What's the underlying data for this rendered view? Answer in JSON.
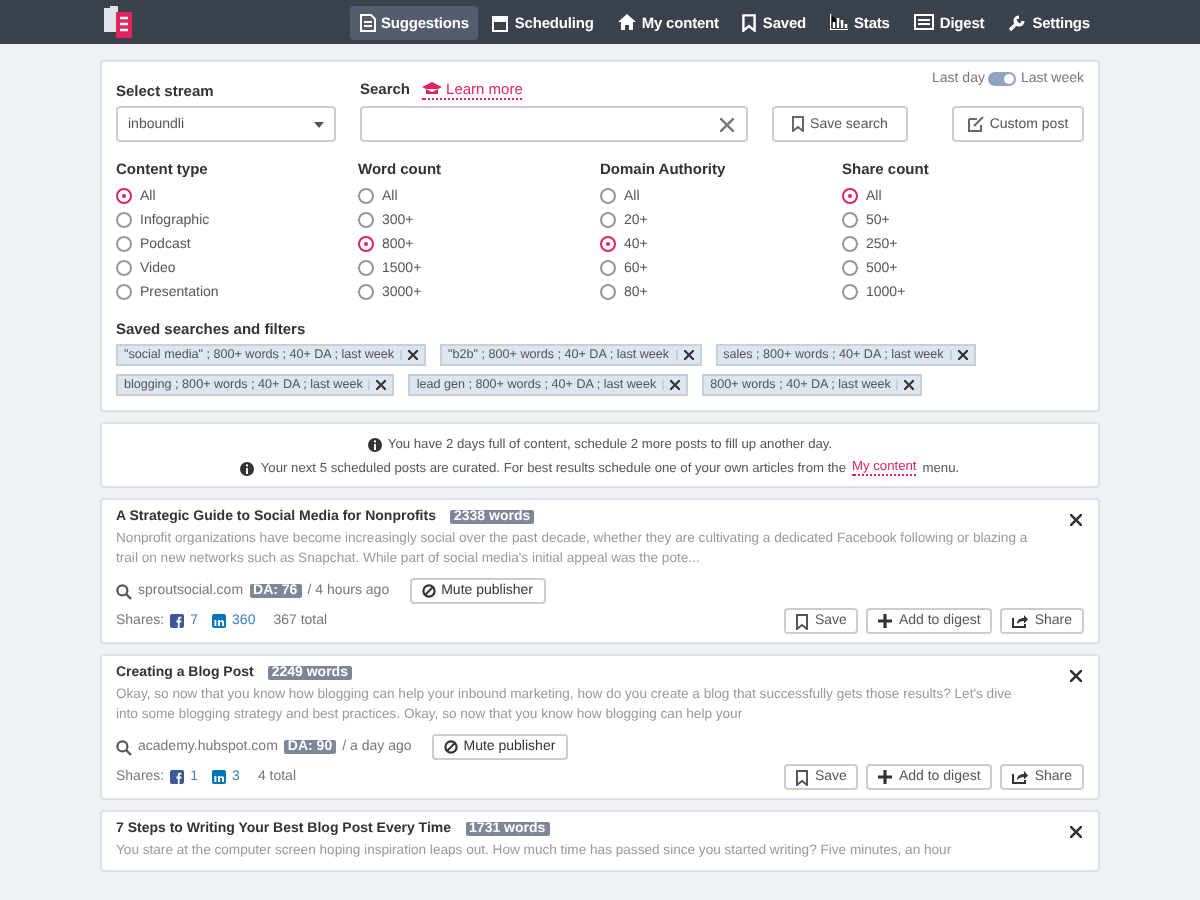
{
  "nav": {
    "items": [
      {
        "label": "Suggestions",
        "selected": true
      },
      {
        "label": "Scheduling",
        "selected": false
      },
      {
        "label": "My content",
        "selected": false
      },
      {
        "label": "Saved",
        "selected": false
      },
      {
        "label": "Stats",
        "selected": false
      },
      {
        "label": "Digest",
        "selected": false
      },
      {
        "label": "Settings",
        "selected": false
      }
    ]
  },
  "period": {
    "left": "Last day",
    "right": "Last week",
    "on": true
  },
  "stream": {
    "label": "Select stream",
    "value": "inboundli"
  },
  "search": {
    "label": "Search",
    "link": "Learn more",
    "save": "Save search",
    "custom": "Custom post"
  },
  "filters": [
    {
      "title": "Content type",
      "options": [
        {
          "label": "All",
          "selected": true
        },
        {
          "label": "Infographic",
          "selected": false
        },
        {
          "label": "Podcast",
          "selected": false
        },
        {
          "label": "Video",
          "selected": false
        },
        {
          "label": "Presentation",
          "selected": false
        }
      ]
    },
    {
      "title": "Word count",
      "options": [
        {
          "label": "All",
          "selected": false
        },
        {
          "label": "300+",
          "selected": false
        },
        {
          "label": "800+",
          "selected": true
        },
        {
          "label": "1500+",
          "selected": false
        },
        {
          "label": "3000+",
          "selected": false
        }
      ]
    },
    {
      "title": "Domain Authority",
      "options": [
        {
          "label": "All",
          "selected": false
        },
        {
          "label": "20+",
          "selected": false
        },
        {
          "label": "40+",
          "selected": true
        },
        {
          "label": "60+",
          "selected": false
        },
        {
          "label": "80+",
          "selected": false
        }
      ]
    },
    {
      "title": "Share count",
      "options": [
        {
          "label": "All",
          "selected": true
        },
        {
          "label": "50+",
          "selected": false
        },
        {
          "label": "250+",
          "selected": false
        },
        {
          "label": "500+",
          "selected": false
        },
        {
          "label": "1000+",
          "selected": false
        }
      ]
    }
  ],
  "saved": {
    "title": "Saved searches and filters",
    "tags": [
      "\"social media\" ; 800+ words ; 40+ DA ; last week",
      "\"b2b\" ; 800+ words ; 40+ DA ; last week",
      "sales ; 800+ words ; 40+ DA ; last week",
      "blogging ; 800+ words ; 40+ DA ; last week",
      "lead gen ; 800+ words ; 40+ DA ; last week",
      "800+ words ; 40+ DA ; last week"
    ]
  },
  "notices": [
    {
      "text": "You have 2 days full of content, schedule 2 more posts to fill up another day."
    },
    {
      "text": "Your next 5 scheduled posts are curated. For best results schedule one of your own articles from the",
      "link": "My content",
      "after": "menu."
    }
  ],
  "articles": [
    {
      "title": "A Strategic Guide to Social Media for Nonprofits",
      "words": "2338 words",
      "excerpt": "Nonprofit organizations have become increasingly social over the past decade, whether they are cultivating a dedicated Facebook following or blazing a trail on new networks such as Snapchat. While part of social media's initial appeal was the pote...",
      "source": "sproutsocial.com",
      "da": "DA: 76",
      "time": "/ 4 hours ago",
      "mute": "Mute publisher",
      "shares_label": "Shares:",
      "facebook": "7",
      "linkedin": "360",
      "total": "367 total",
      "actions": [
        "Save",
        "Add to digest",
        "Share"
      ]
    },
    {
      "title": "Creating a Blog Post",
      "words": "2249 words",
      "excerpt": "Okay, so now that you know how blogging can help your inbound marketing, how do you create a blog that successfully gets those results? Let's dive into some blogging strategy and best practices. Okay, so now that you know how blogging can help your",
      "source": "academy.hubspot.com",
      "da": "DA: 90",
      "time": "/ a day ago",
      "mute": "Mute publisher",
      "shares_label": "Shares:",
      "facebook": "1",
      "linkedin": "3",
      "total": "4 total",
      "actions": [
        "Save",
        "Add to digest",
        "Share"
      ]
    },
    {
      "title": "7 Steps to Writing Your Best Blog Post Every Time",
      "words": "1731 words",
      "excerpt": "You stare at the computer screen hoping inspiration leaps out. How much time has passed since you started writing? Five minutes, an hour"
    }
  ]
}
